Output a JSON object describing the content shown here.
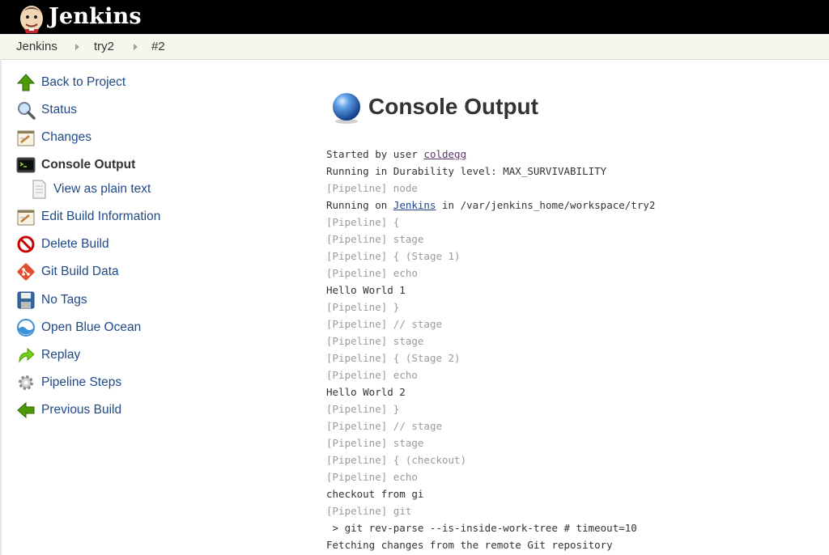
{
  "header": {
    "brand": "Jenkins"
  },
  "breadcrumb": [
    {
      "label": "Jenkins"
    },
    {
      "label": "try2"
    },
    {
      "label": "#2"
    }
  ],
  "sidebar": {
    "items": [
      {
        "label": "Back to Project",
        "icon": "up-arrow-icon"
      },
      {
        "label": "Status",
        "icon": "magnifier-icon"
      },
      {
        "label": "Changes",
        "icon": "notepad-icon"
      },
      {
        "label": "Console Output",
        "icon": "terminal-icon",
        "current": true
      },
      {
        "label": "View as plain text",
        "icon": "document-icon",
        "sub": true
      },
      {
        "label": "Edit Build Information",
        "icon": "notepad-pencil-icon"
      },
      {
        "label": "Delete Build",
        "icon": "no-entry-icon"
      },
      {
        "label": "Git Build Data",
        "icon": "git-icon"
      },
      {
        "label": "No Tags",
        "icon": "floppy-disk-icon"
      },
      {
        "label": "Open Blue Ocean",
        "icon": "blue-ocean-icon"
      },
      {
        "label": "Replay",
        "icon": "replay-arrow-icon"
      },
      {
        "label": "Pipeline Steps",
        "icon": "gear-icon"
      },
      {
        "label": "Previous Build",
        "icon": "left-arrow-icon"
      }
    ]
  },
  "main": {
    "title": "Console Output"
  },
  "console": {
    "started_prefix": "Started by user ",
    "started_user": "coldegg",
    "durability": "Running in Durability level: MAX_SURVIVABILITY",
    "pipeline_prefix": "[Pipeline]",
    "node_step": " node",
    "running_on_prefix": "Running on ",
    "running_on_link": "Jenkins",
    "running_on_suffix": " in /var/jenkins_home/workspace/try2",
    "p1": " {",
    "p2": " stage",
    "p3": " { (Stage 1)",
    "p4": " echo",
    "hello1": "Hello World 1",
    "p5": " }",
    "p6": " // stage",
    "p7": " stage",
    "p8": " { (Stage 2)",
    "p9": " echo",
    "hello2": "Hello World 2",
    "p10": " }",
    "p11": " // stage",
    "p12": " stage",
    "p13": " { (checkout)",
    "p14": " echo",
    "checkout": "checkout from gi",
    "p15": " git",
    "git_cmd": " > git rev-parse --is-inside-work-tree # timeout=10",
    "fetching": "Fetching changes from the remote Git repository"
  },
  "colors": {
    "header_bg": "#000000",
    "breadcrumb_bg": "#f4f7ec",
    "link": "#204a87",
    "visited_link": "#5c3566",
    "pipeline_gray": "#9a9a9a"
  }
}
